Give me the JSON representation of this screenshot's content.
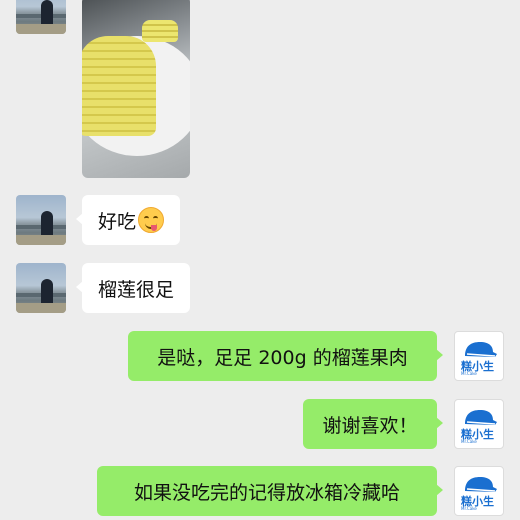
{
  "messages": {
    "m1": {
      "text": "好吃",
      "emoji": "savoring-food-emoji"
    },
    "m2": {
      "text": "榴莲很足"
    },
    "m3": {
      "text": "是哒，足足 200g 的榴莲果肉"
    },
    "m4": {
      "text": "谢谢喜欢！"
    },
    "m5": {
      "text": "如果没吃完的记得放冰箱冷藏哈"
    }
  },
  "shop_avatar": {
    "brand": "糕小生",
    "subtitle": "Mr.Cake"
  },
  "colors": {
    "background": "#ededed",
    "outgoing_bubble": "#95ec69",
    "incoming_bubble": "#ffffff",
    "brand_blue": "#1a6fd0"
  }
}
